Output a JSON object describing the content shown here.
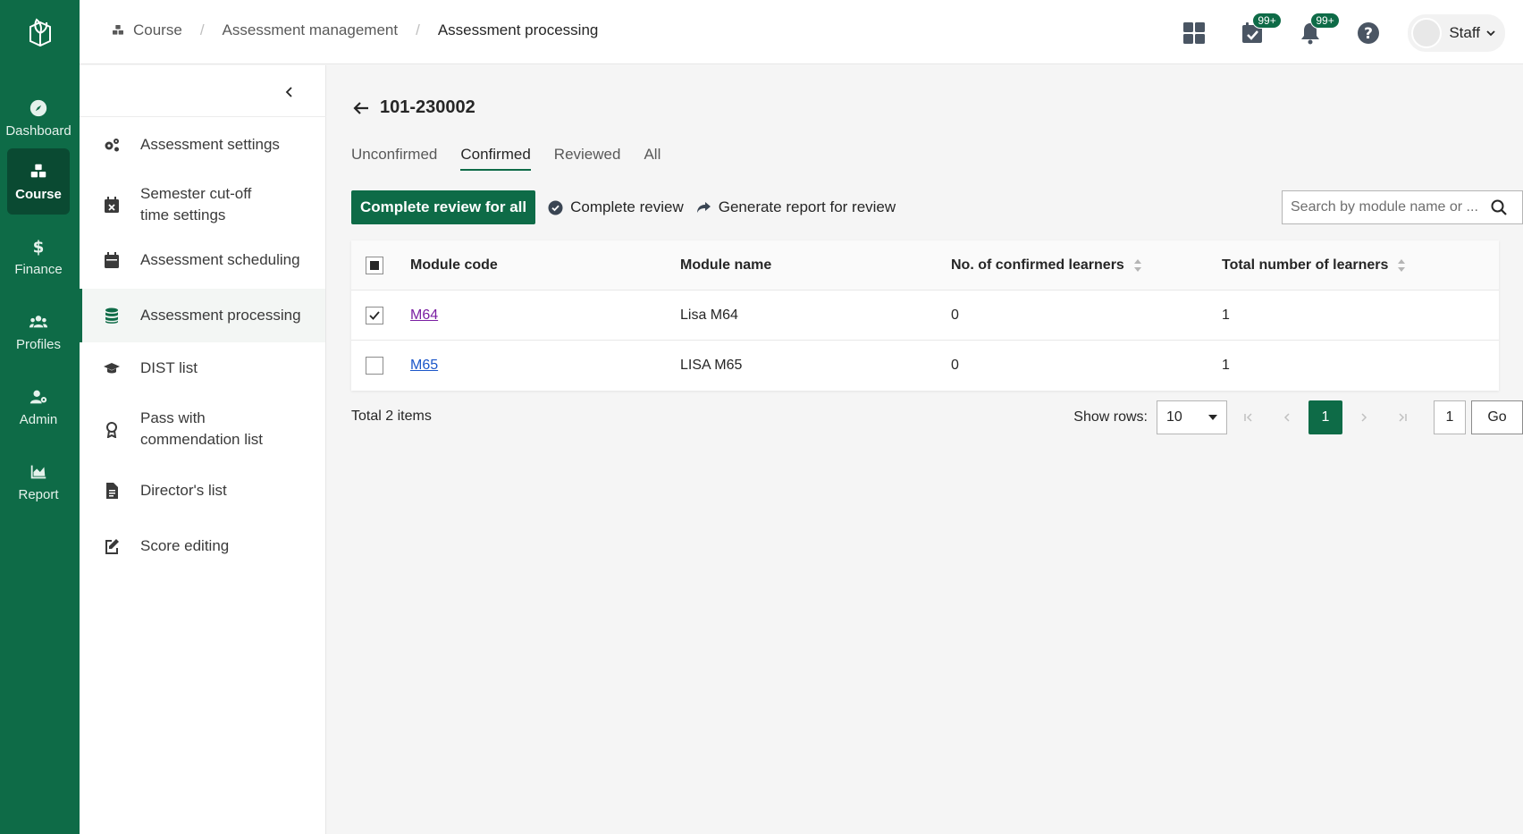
{
  "nav": {
    "items": [
      {
        "label": "Dashboard",
        "icon": "compass-icon"
      },
      {
        "label": "Course",
        "icon": "cubes-icon"
      },
      {
        "label": "Finance",
        "icon": "dollar-icon"
      },
      {
        "label": "Profiles",
        "icon": "users-icon"
      },
      {
        "label": "Admin",
        "icon": "user-gear-icon"
      },
      {
        "label": "Report",
        "icon": "area-chart-icon"
      }
    ],
    "active": "Course"
  },
  "breadcrumb": [
    "Course",
    "Assessment management",
    "Assessment processing"
  ],
  "topbar": {
    "tasks_badge": "99+",
    "notifications_badge": "99+",
    "user_name": "Staff"
  },
  "subnav": {
    "items": [
      {
        "label": "Assessment settings",
        "icon": "gears-icon"
      },
      {
        "label": "Semester cut-off time settings",
        "icon": "calendar-x-icon"
      },
      {
        "label": "Assessment scheduling",
        "icon": "calendar-icon"
      },
      {
        "label": "Assessment processing",
        "icon": "database-icon"
      },
      {
        "label": "DIST list",
        "icon": "graduation-cap-icon"
      },
      {
        "label": "Pass with commendation list",
        "icon": "award-icon"
      },
      {
        "label": "Director's list",
        "icon": "document-icon"
      },
      {
        "label": "Score editing",
        "icon": "edit-icon"
      }
    ],
    "active": "Assessment processing"
  },
  "page": {
    "record_id": "101-230002",
    "tabs": [
      "Unconfirmed",
      "Confirmed",
      "Reviewed",
      "All"
    ],
    "active_tab": "Confirmed"
  },
  "toolbar": {
    "complete_all_label": "Complete review for all",
    "complete_label": "Complete review",
    "generate_label": "Generate report for review",
    "search_placeholder": "Search by module name or ..."
  },
  "table": {
    "columns": [
      "Module code",
      "Module name",
      "No. of confirmed learners",
      "Total number of learners"
    ],
    "rows": [
      {
        "code": "M64",
        "name": "Lisa M64",
        "confirmed": "0",
        "total": "1",
        "checked": true
      },
      {
        "code": "M65",
        "name": "LISA M65",
        "confirmed": "0",
        "total": "1",
        "checked": false
      }
    ]
  },
  "pagination": {
    "total_text": "Total 2 items",
    "rows_label": "Show rows:",
    "rows_value": "10",
    "current_page": "1",
    "goto_value": "1",
    "go_label": "Go"
  },
  "colors": {
    "brand": "#0e6b47",
    "brand_dark": "#0a4a32",
    "link": "#1b56c9",
    "visited_link": "#7a1fa2"
  }
}
